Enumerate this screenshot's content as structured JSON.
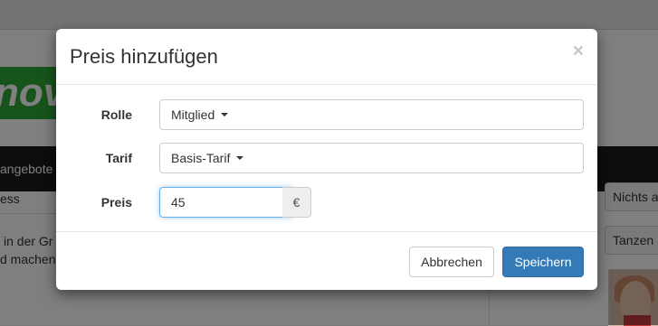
{
  "background": {
    "logo_text": "nove",
    "nav_item": "angebote",
    "text_1": "ess",
    "text_2": "in der Gr",
    "text_3": "d machen",
    "right_button_1": "Nichts a",
    "right_button_2": "Tanzen"
  },
  "modal": {
    "title": "Preis hinzufügen",
    "close": "×",
    "role": {
      "label": "Rolle",
      "value": "Mitglied"
    },
    "tariff": {
      "label": "Tarif",
      "value": "Basis-Tarif"
    },
    "price": {
      "label": "Preis",
      "value": "45",
      "currency": "€"
    },
    "cancel_label": "Abbrechen",
    "save_label": "Speichern"
  },
  "colors": {
    "primary": "#337ab7",
    "focus_border": "#66afe9",
    "logo_green": "#2ea836",
    "nav_dark": "#1b1b1b"
  }
}
